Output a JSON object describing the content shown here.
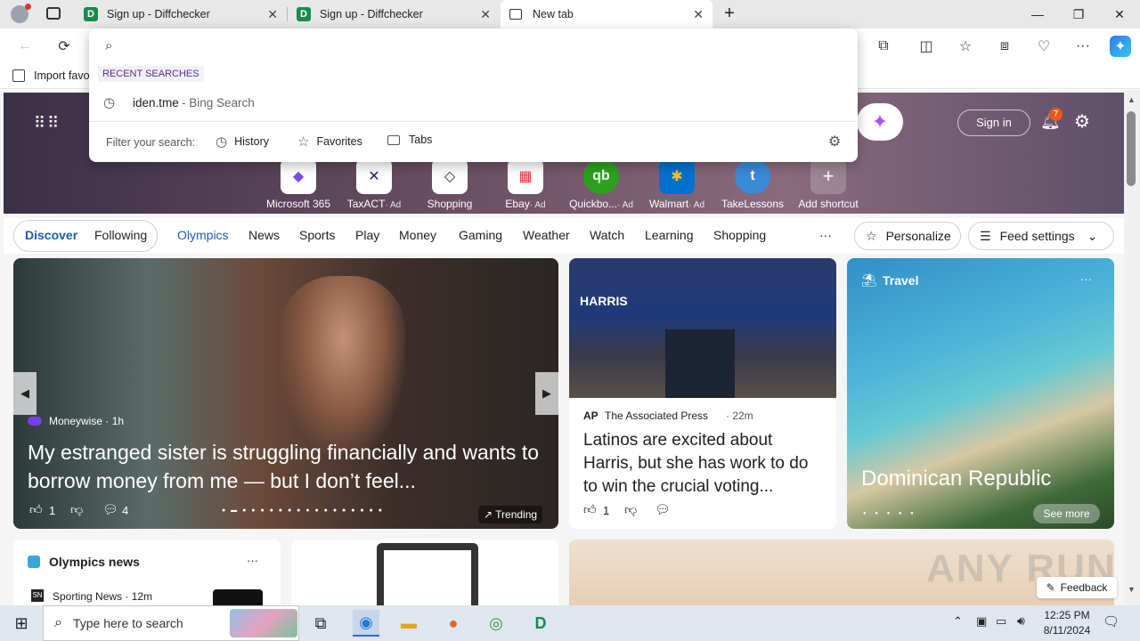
{
  "tabs": [
    {
      "title": "Sign up - Diffchecker",
      "favicon": "D"
    },
    {
      "title": "Sign up - Diffchecker",
      "favicon": "D"
    },
    {
      "title": "New tab"
    }
  ],
  "omnibox": {
    "section_label": "RECENT SEARCHES",
    "recent": {
      "query": "iden.tme",
      "suffix": " - Bing Search"
    },
    "filter_label": "Filter your search:",
    "filters": [
      "History",
      "Favorites",
      "Tabs"
    ]
  },
  "favorites_bar": {
    "import_label": "Import favo"
  },
  "header": {
    "sign_in": "Sign in",
    "notif_count": "7"
  },
  "shortcuts": [
    {
      "label": "Microsoft 365",
      "ad": ""
    },
    {
      "label": "TaxACT",
      "ad": "· Ad"
    },
    {
      "label": "Shopping",
      "ad": ""
    },
    {
      "label": "Ebay",
      "ad": "· Ad"
    },
    {
      "label": "Quickbo...",
      "ad": "· Ad"
    },
    {
      "label": "Walmart",
      "ad": "· Ad"
    },
    {
      "label": "TakeLessons",
      "ad": ""
    },
    {
      "label": "Add shortcut",
      "ad": ""
    }
  ],
  "nav": {
    "discover": "Discover",
    "following": "Following",
    "items": [
      "Olympics",
      "News",
      "Sports",
      "Play",
      "Money",
      "Gaming",
      "Weather",
      "Watch",
      "Learning",
      "Shopping"
    ],
    "more": "···",
    "personalize": "Personalize",
    "feed_settings": "Feed settings"
  },
  "main_card": {
    "source": "Moneywise · 1h",
    "headline": "My estranged sister is struggling financially and wants to borrow money from me — but I don’t feel...",
    "likes": "1",
    "comments": "4",
    "trending": "Trending"
  },
  "news_card": {
    "source": "The Associated Press",
    "time": "· 22m",
    "headline": "Latinos are excited about Harris, but she has work to do to win the crucial voting...",
    "likes": "1",
    "image_text": "HARRIS"
  },
  "travel_card": {
    "category": "Travel",
    "title": "Dominican Republic",
    "see_more": "See more"
  },
  "olympics_card": {
    "title": "Olympics news",
    "source": "Sporting News · 12m"
  },
  "feedback": "Feedback",
  "watermark": "ANY RUN",
  "taskbar": {
    "search_placeholder": "Type here to search",
    "time": "12:25 PM",
    "date": "8/11/2024"
  }
}
